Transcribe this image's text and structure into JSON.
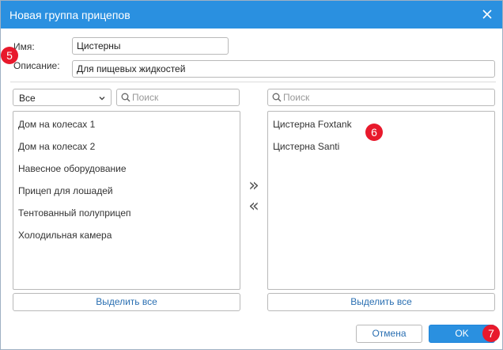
{
  "dialog": {
    "title": "Новая группа прицепов",
    "close_icon": "close-icon"
  },
  "form": {
    "name_label": "Имя:",
    "name_value": "Цистерны",
    "description_label": "Описание:",
    "description_value": "Для пищевых жидкостей"
  },
  "left_panel": {
    "filter_value": "Все",
    "search_placeholder": "Поиск",
    "items": [
      {
        "label": "Дом на колесах 1"
      },
      {
        "label": "Дом на колесах 2"
      },
      {
        "label": "Навесное оборудование"
      },
      {
        "label": "Прицеп для лошадей"
      },
      {
        "label": "Тентованный полуприцеп"
      },
      {
        "label": "Холодильная камера"
      }
    ],
    "select_all_label": "Выделить все"
  },
  "transfer": {
    "add_label": "»",
    "remove_label": "«"
  },
  "right_panel": {
    "search_placeholder": "Поиск",
    "items": [
      {
        "label": "Цистерна Foxtank"
      },
      {
        "label": "Цистерна Santi"
      }
    ],
    "select_all_label": "Выделить все"
  },
  "footer": {
    "cancel_label": "Отмена",
    "ok_label": "OK"
  },
  "badges": {
    "form_badge": "5",
    "list_badge": "6",
    "ok_badge": "7"
  },
  "colors": {
    "titlebar": "#2a90e0",
    "accent_text": "#2a6fb2",
    "badge": "#e8192c"
  }
}
